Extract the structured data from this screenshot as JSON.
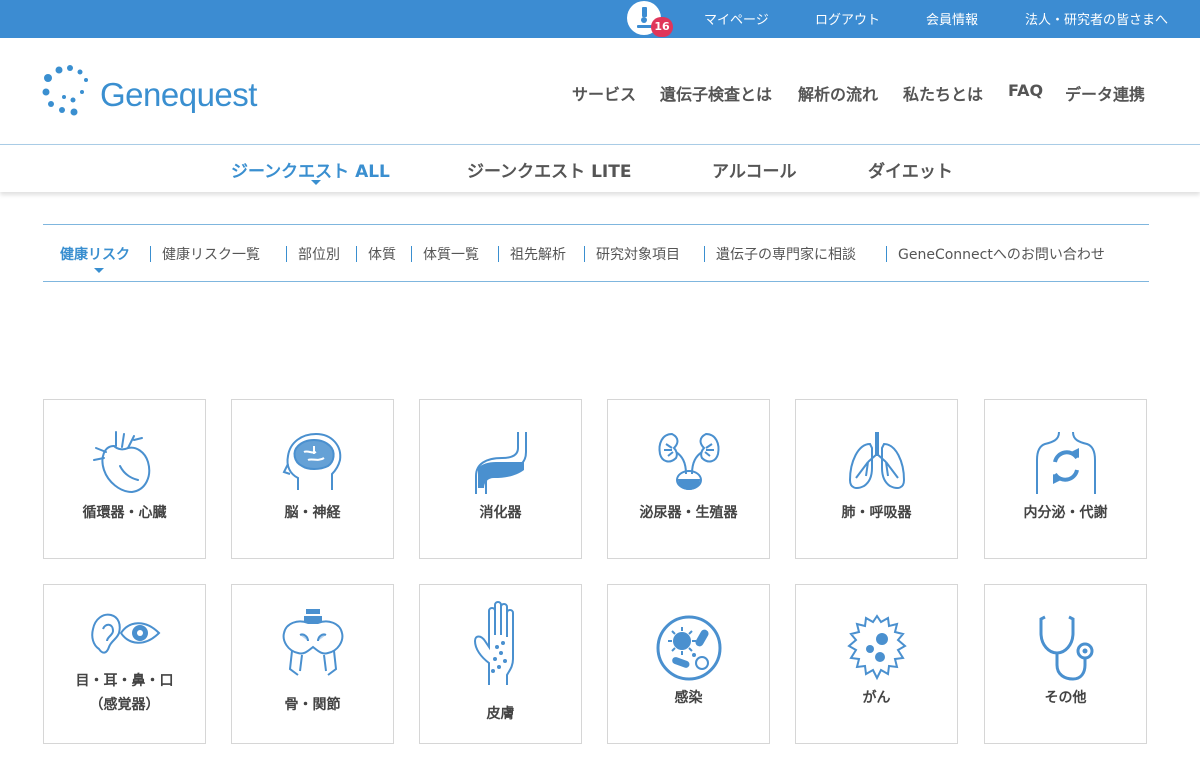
{
  "topbar": {
    "notification_count": "16",
    "links": [
      "マイページ",
      "ログアウト",
      "会員情報",
      "法人・研究者の皆さまへ"
    ]
  },
  "header": {
    "logo_text": "Genequest",
    "nav": [
      "サービス",
      "遺伝子検査とは",
      "解析の流れ",
      "私たちとは",
      "FAQ",
      "データ連携"
    ]
  },
  "product_tabs": {
    "items": [
      "ジーンクエスト ALL",
      "ジーンクエスト LITE",
      "アルコール",
      "ダイエット"
    ],
    "active_index": 0
  },
  "subnav": {
    "items": [
      "健康リスク",
      "健康リスク一覧",
      "部位別",
      "体質",
      "体質一覧",
      "祖先解析",
      "研究対象項目",
      "遺伝子の専門家に相談",
      "GeneConnectへのお問い合わせ"
    ],
    "active_index": 0
  },
  "categories": {
    "row1": [
      {
        "label": "循環器・心臓",
        "icon": "heart-icon"
      },
      {
        "label": "脳・神経",
        "icon": "brain-icon"
      },
      {
        "label": "消化器",
        "icon": "stomach-icon"
      },
      {
        "label": "泌尿器・生殖器",
        "icon": "kidney-icon"
      },
      {
        "label": "肺・呼吸器",
        "icon": "lungs-icon"
      },
      {
        "label": "内分泌・代謝",
        "icon": "metabolism-icon"
      }
    ],
    "row2": [
      {
        "label_line1": "目・耳・鼻・口",
        "label_line2": "（感覚器）",
        "icon": "ear-eye-icon"
      },
      {
        "label": "骨・関節",
        "icon": "bone-icon"
      },
      {
        "label": "皮膚",
        "icon": "hand-skin-icon"
      },
      {
        "label": "感染",
        "icon": "germ-icon"
      },
      {
        "label": "がん",
        "icon": "cancer-cell-icon"
      },
      {
        "label": "その他",
        "icon": "stethoscope-icon"
      }
    ]
  },
  "colors": {
    "topbar": "#3c8cd2",
    "accent": "#3a8fd0",
    "badge": "#e0365a",
    "icon_stroke": "#4a90cf"
  }
}
